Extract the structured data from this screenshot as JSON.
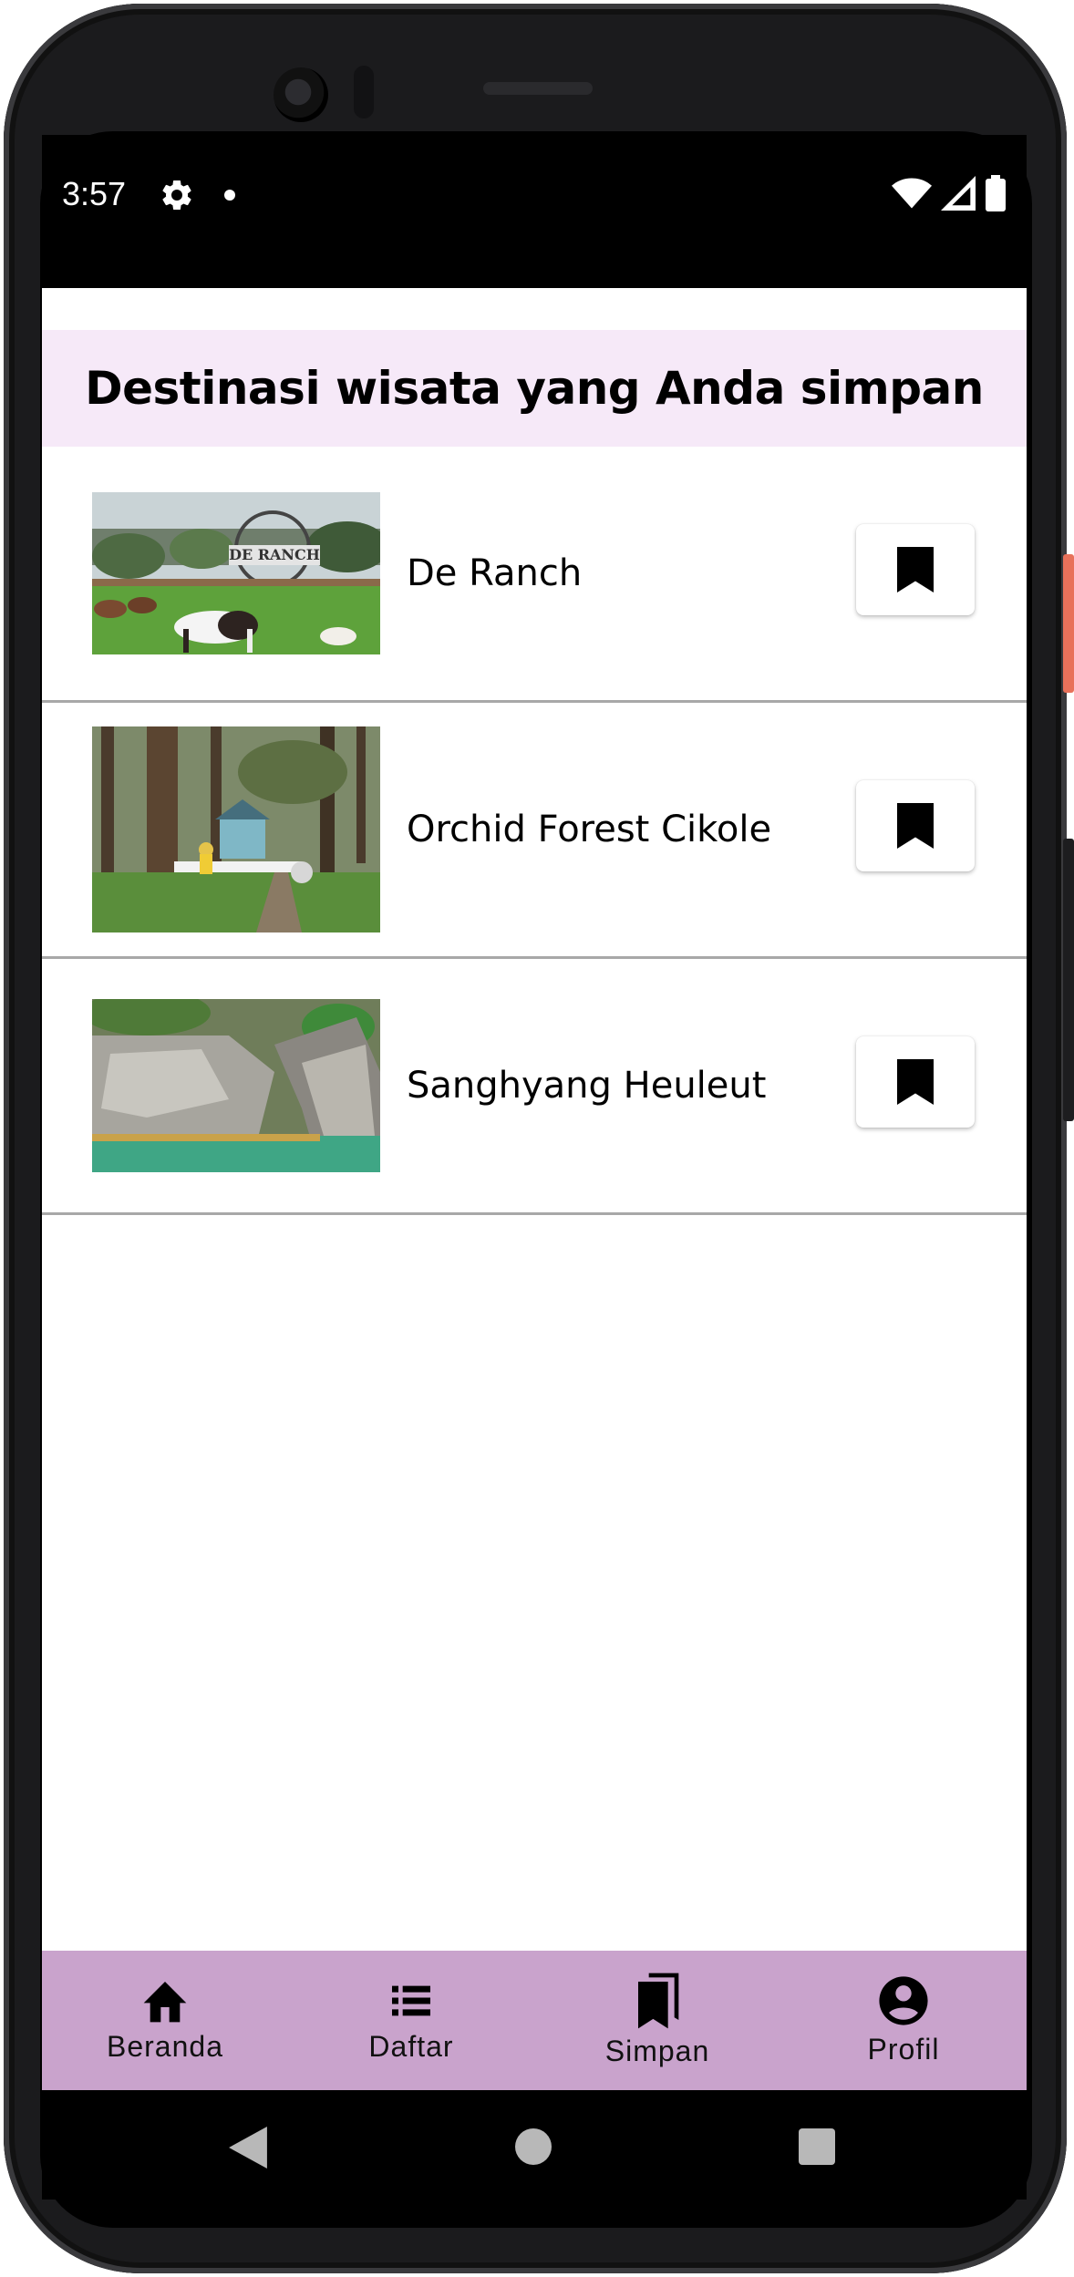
{
  "status_bar": {
    "time": "3:57",
    "gear_icon": "settings-gear-icon",
    "dot_icon": "notification-dot-icon"
  },
  "header": {
    "title": "Destinasi wisata yang Anda simpan"
  },
  "saved": [
    {
      "name": "De Ranch",
      "image_icon": "ranch-photo"
    },
    {
      "name": "Orchid Forest Cikole",
      "image_icon": "forest-photo"
    },
    {
      "name": "Sanghyang Heuleut",
      "image_icon": "canyon-photo"
    }
  ],
  "bottom_nav": [
    {
      "label": "Beranda",
      "icon": "home-icon"
    },
    {
      "label": "Daftar",
      "icon": "list-icon"
    },
    {
      "label": "Simpan",
      "icon": "bookmarks-icon"
    },
    {
      "label": "Profil",
      "icon": "account-circle-icon"
    }
  ],
  "colors": {
    "header_bg": "#f6e9f8",
    "nav_bg": "#c9a3cc",
    "divider": "#a8a8a8"
  }
}
